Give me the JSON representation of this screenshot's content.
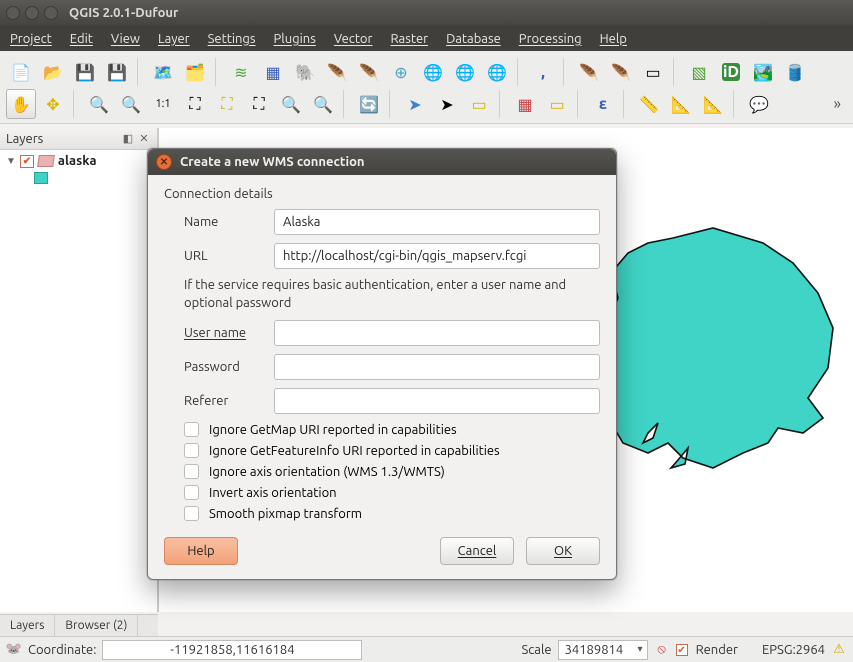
{
  "window": {
    "title": "QGIS 2.0.1-Dufour"
  },
  "menu": {
    "project": "Project",
    "edit": "Edit",
    "view": "View",
    "layer": "Layer",
    "settings": "Settings",
    "plugins": "Plugins",
    "vector": "Vector",
    "raster": "Raster",
    "database": "Database",
    "processing": "Processing",
    "help": "Help"
  },
  "layers_panel": {
    "title": "Layers",
    "layer_name": "alaska",
    "tab_layers": "Layers",
    "tab_browser": "Browser (2)"
  },
  "statusbar": {
    "coord_label": "Coordinate:",
    "coord_value": "-11921858,11616184",
    "scale_label": "Scale",
    "scale_value": "34189814",
    "render_label": "Render",
    "epsg": "EPSG:2964"
  },
  "dialog": {
    "title": "Create a new WMS connection",
    "section": "Connection details",
    "name_label": "Name",
    "name_value": "Alaska",
    "url_label": "URL",
    "url_value": "http://localhost/cgi-bin/qgis_mapserv.fcgi",
    "auth_hint": "If the service requires basic authentication, enter a user name and optional password",
    "user_label": "User name",
    "user_value": "",
    "pass_label": "Password",
    "pass_value": "",
    "ref_label": "Referer",
    "ref_value": "",
    "chk1": "Ignore GetMap URI reported in capabilities",
    "chk2": "Ignore GetFeatureInfo URI reported in capabilities",
    "chk3": "Ignore axis orientation (WMS 1.3/WMTS)",
    "chk4": "Invert axis orientation",
    "chk5": "Smooth pixmap transform",
    "btn_help": "Help",
    "btn_cancel": "Cancel",
    "btn_ok": "OK"
  }
}
